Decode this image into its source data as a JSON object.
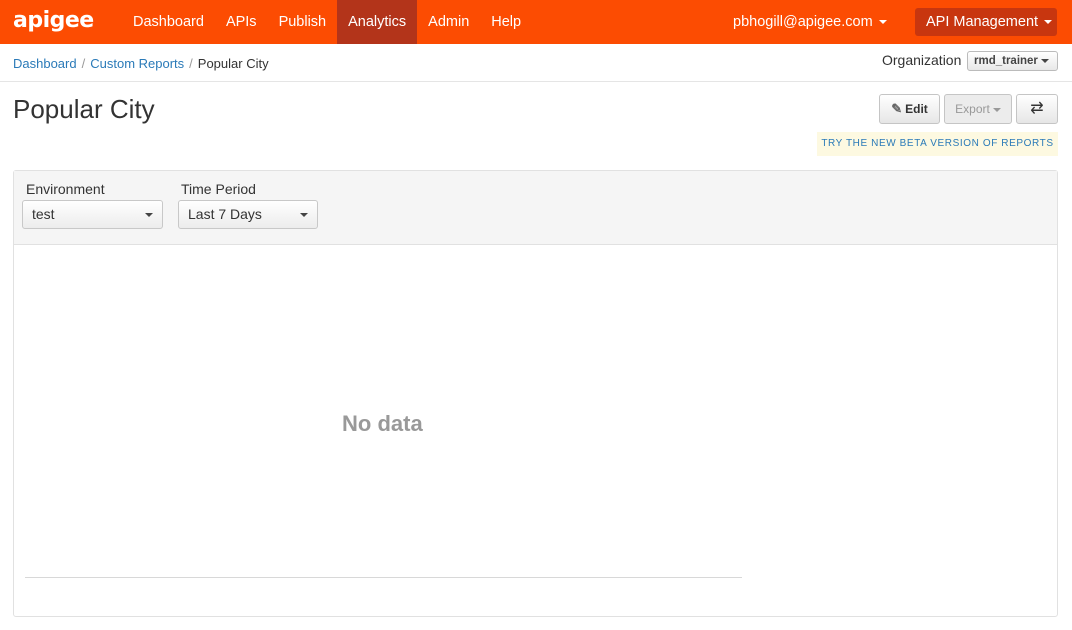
{
  "brand": {
    "logo_text": "apigee",
    "accent": "#fc4c02",
    "active_nav_bg": "#b3341a"
  },
  "nav": {
    "items": [
      {
        "label": "Dashboard",
        "active": false
      },
      {
        "label": "APIs",
        "active": false
      },
      {
        "label": "Publish",
        "active": false
      },
      {
        "label": "Analytics",
        "active": true
      },
      {
        "label": "Admin",
        "active": false
      },
      {
        "label": "Help",
        "active": false
      }
    ],
    "user": "pbhogill@apigee.com",
    "product_menu": "API Management"
  },
  "breadcrumb": {
    "items": [
      {
        "label": "Dashboard",
        "link": true
      },
      {
        "label": "Custom Reports",
        "link": true
      },
      {
        "label": "Popular City",
        "link": false
      }
    ]
  },
  "organization": {
    "label": "Organization",
    "selected": "rmd_trainer"
  },
  "page": {
    "title": "Popular City",
    "edit_label": "Edit",
    "export_label": "Export",
    "refresh_icon": "refresh-icon",
    "beta_link": "TRY THE NEW BETA VERSION OF REPORTS"
  },
  "filters": {
    "environment": {
      "label": "Environment",
      "selected": "test"
    },
    "time_period": {
      "label": "Time Period",
      "selected": "Last 7 Days"
    }
  },
  "report": {
    "empty_message": "No data"
  }
}
